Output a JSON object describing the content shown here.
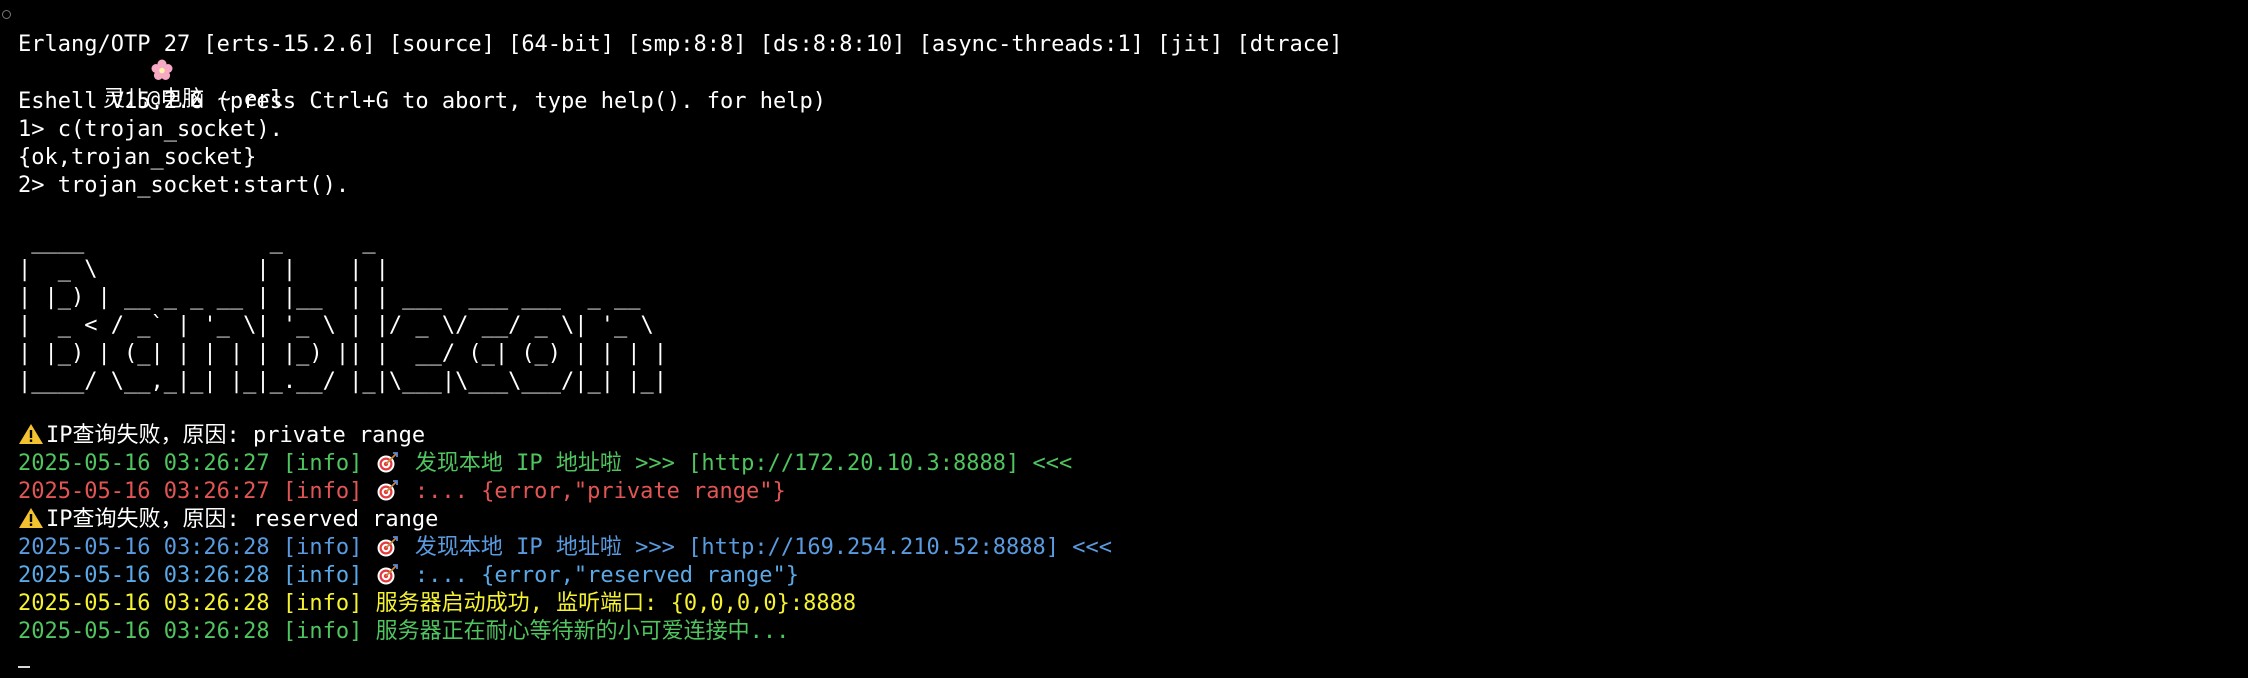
{
  "prompt": {
    "text": "灵儿@电脑 ~ erl",
    "icon": "flower-icon"
  },
  "lines": {
    "otp": "Erlang/OTP 27 [erts-15.2.6] [source] [64-bit] [smp:8:8] [ds:8:8:10] [async-threads:1] [jit] [dtrace]",
    "eshell": "Eshell V15.2.6 (press Ctrl+G to abort, type help(). for help)",
    "cmd1": "1> c(trojan_socket).",
    "ok": "{ok,trojan_socket}",
    "cmd2": "2> trojan_socket:start()."
  },
  "banner": " ____              _      _\n|  _ \\            | |    | |\n| |_) | __ _ _ __ | |__  | | ___  ___ ___  _ __\n|  _ < / _` | '_ \\| '_ \\ | |/ _ \\/ __/ _ \\| '_ \\\n| |_) | (_| | | | | |_) || |  __/ (_| (_) | | | |\n|____/ \\__,_|_| |_|_.__/ |_|\\___|\\___\\___/|_| |_|",
  "logs": [
    {
      "kind": "warning",
      "message": "IP查询失败，原因: private range",
      "color": "#ffffff"
    },
    {
      "kind": "log",
      "timestamp": "2025-05-16 03:26:27",
      "level": "[info]",
      "message": "发现本地 IP 地址啦 >>> [http://172.20.10.3:8888] <<<",
      "color": "#4fc45f"
    },
    {
      "kind": "log",
      "timestamp": "2025-05-16 03:26:27",
      "level": "[info]",
      "message": ":... {error,\"private range\"}",
      "color": "#e25555"
    },
    {
      "kind": "warning",
      "message": "IP查询失败，原因: reserved range",
      "color": "#ffffff"
    },
    {
      "kind": "log",
      "timestamp": "2025-05-16 03:26:28",
      "level": "[info]",
      "message": "发现本地 IP 地址啦 >>> [http://169.254.210.52:8888] <<<",
      "color": "#5a9be0"
    },
    {
      "kind": "log",
      "timestamp": "2025-05-16 03:26:28",
      "level": "[info]",
      "message": ":... {error,\"reserved range\"}",
      "color": "#5aa8e6"
    },
    {
      "kind": "plain",
      "timestamp": "2025-05-16 03:26:28",
      "level": "[info]",
      "message": "服务器启动成功, 监听端口: {0,0,0,0}:8888",
      "color": "#f5f232"
    },
    {
      "kind": "plain",
      "timestamp": "2025-05-16 03:26:28",
      "level": "[info]",
      "message": "服务器正在耐心等待新的小可爱连接中...",
      "color": "#4fc45f"
    }
  ],
  "colors": {
    "background": "#000000",
    "text": "#ffffff",
    "green": "#4fc45f",
    "red": "#e25555",
    "blue": "#5a9be0",
    "yellow": "#f5f232",
    "warning": "#f2c230",
    "target_red": "#e33b3b"
  }
}
